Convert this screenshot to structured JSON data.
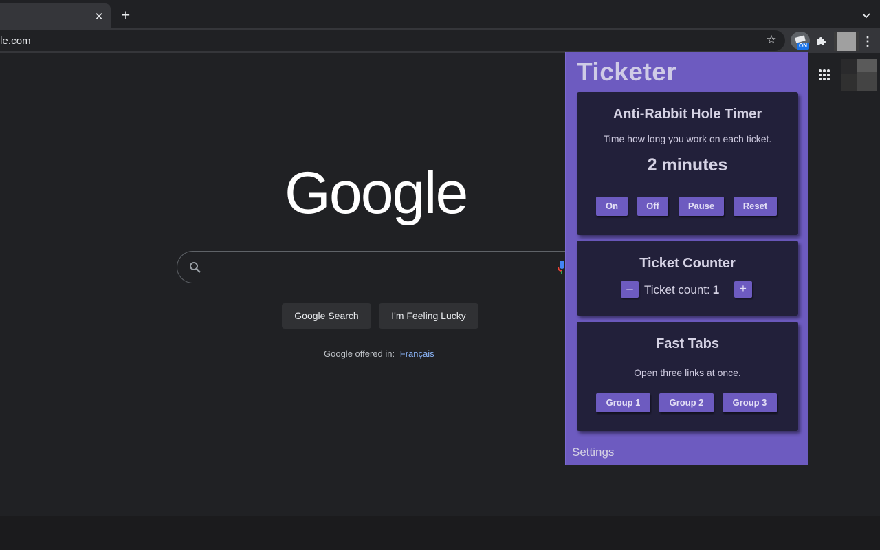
{
  "browser": {
    "tab_close": "✕",
    "new_tab": "+",
    "url": "le.com",
    "star": "☆",
    "ext_badge": "ON",
    "menu": "⋮"
  },
  "google": {
    "logo": "Google",
    "search_button": "Google Search",
    "lucky_button": "I'm Feeling Lucky",
    "offered_in": "Google offered in:",
    "offered_lang": "Français"
  },
  "popup": {
    "title": "Ticketer",
    "timer_card": {
      "title": "Anti-Rabbit Hole Timer",
      "desc": "Time how long you work on each ticket.",
      "time": "2 minutes",
      "on": "On",
      "off": "Off",
      "pause": "Pause",
      "reset": "Reset"
    },
    "counter_card": {
      "title": "Ticket Counter",
      "minus": "–",
      "plus": "+",
      "label": "Ticket count:",
      "value": "1"
    },
    "tabs_card": {
      "title": "Fast Tabs",
      "desc": "Open three links at once.",
      "group1": "Group 1",
      "group2": "Group 2",
      "group3": "Group 3"
    },
    "settings": "Settings"
  },
  "colors": {
    "popup_bg": "#6d5bc0",
    "card_bg": "#22203a",
    "page_bg": "#202124",
    "link": "#8ab4f8"
  }
}
